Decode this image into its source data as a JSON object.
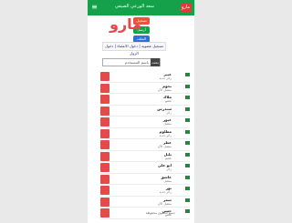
{
  "header": {
    "title": "سعد الورعي الصيفي",
    "menu_icon": "hamburger-icon",
    "logo_text": "مارو"
  },
  "side_buttons": [
    {
      "label": "تسجيل",
      "color": "#e8543b"
    },
    {
      "label": "أرسل",
      "color": "#15a04a"
    },
    {
      "label": "الملف",
      "color": "#2f6fd6"
    }
  ],
  "nav": {
    "label": "تسجيل عضوية | دخول الاعضاء | دخول الزوار"
  },
  "search": {
    "placeholder": "ابحث باسم المستخدم",
    "button_label": "بحث"
  },
  "users": [
    {
      "name": "عبير",
      "sub": "زائر جديد"
    },
    {
      "name": "نجوم",
      "sub": "متصل الآن"
    },
    {
      "name": "ملاك",
      "sub": "عضو"
    },
    {
      "name": "سندرس",
      "sub": "زائر"
    },
    {
      "name": "غيور",
      "sub": "متصل"
    },
    {
      "name": "مظلوم",
      "sub": "زائر جديد"
    },
    {
      "name": "عطر",
      "sub": "متصل الآن"
    },
    {
      "name": "بلبل",
      "sub": "عضو"
    },
    {
      "name": "ابو علي",
      "sub": "زائر"
    },
    {
      "name": "عاشق",
      "sub": "متصل"
    },
    {
      "name": "نور",
      "sub": "زائر جديد"
    },
    {
      "name": "سمر",
      "sub": "متصل الآن"
    },
    {
      "name": "حسن",
      "sub": "عضو"
    }
  ],
  "footer_credit": "جميع الحقوق محفوظة"
}
